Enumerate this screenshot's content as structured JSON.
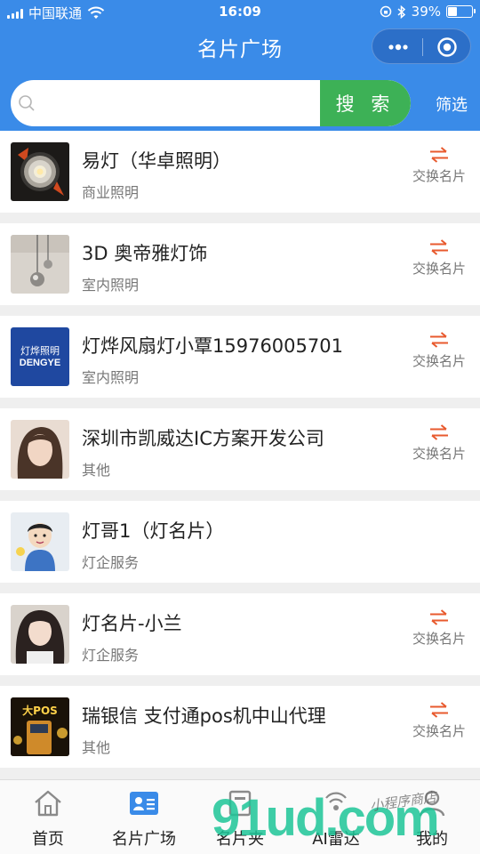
{
  "status_bar": {
    "carrier": "中国联通",
    "time": "16:09",
    "battery": "39%",
    "battery_level": 0.39
  },
  "header": {
    "title": "名片广场"
  },
  "search": {
    "placeholder": "",
    "value": "",
    "button_label": "搜 索",
    "filter_label": "筛选"
  },
  "cards": [
    {
      "name": "易灯（华卓照明）",
      "category": "商业照明",
      "exchange_label": "交换名片",
      "avatar": "downlight-photo"
    },
    {
      "name": "3D 奥帝雅灯饰",
      "category": "室内照明",
      "exchange_label": "交换名片",
      "avatar": "pendant-lamp-photo"
    },
    {
      "name": "灯烨风扇灯小覃15976005701",
      "category": "室内照明",
      "exchange_label": "交换名片",
      "avatar": "dengye-logo",
      "logo_text": "灯烨照明",
      "logo_sub": "DENGYE"
    },
    {
      "name": "深圳市凯威达IC方案开发公司",
      "category": "其他",
      "exchange_label": "交换名片",
      "avatar": "person-photo"
    },
    {
      "name": "灯哥1（灯名片）",
      "category": "灯企服务",
      "exchange_label": "",
      "avatar": "cartoon-man"
    },
    {
      "name": "灯名片-小兰",
      "category": "灯企服务",
      "exchange_label": "交换名片",
      "avatar": "person-photo"
    },
    {
      "name": "瑞银信 支付通pos机中山代理",
      "category": "其他",
      "exchange_label": "交换名片",
      "avatar": "pos-ad-image",
      "logo_text": "大POS"
    }
  ],
  "tabbar": {
    "items": [
      {
        "label": "首页",
        "icon": "home-icon",
        "active": false
      },
      {
        "label": "名片广场",
        "icon": "card-icon",
        "active": true
      },
      {
        "label": "名片夹",
        "icon": "folder-icon",
        "active": false
      },
      {
        "label": "AI雷达",
        "icon": "radar-icon",
        "active": false
      },
      {
        "label": "我的",
        "icon": "profile-icon",
        "active": false
      }
    ]
  },
  "watermark": {
    "text": "91ud.com",
    "script": "小程序商店"
  },
  "colors": {
    "header_blue": "#3a8be8",
    "search_green": "#3db156",
    "exchange_arrow": "#e85a2e",
    "active_tab": "#3a8be8"
  }
}
